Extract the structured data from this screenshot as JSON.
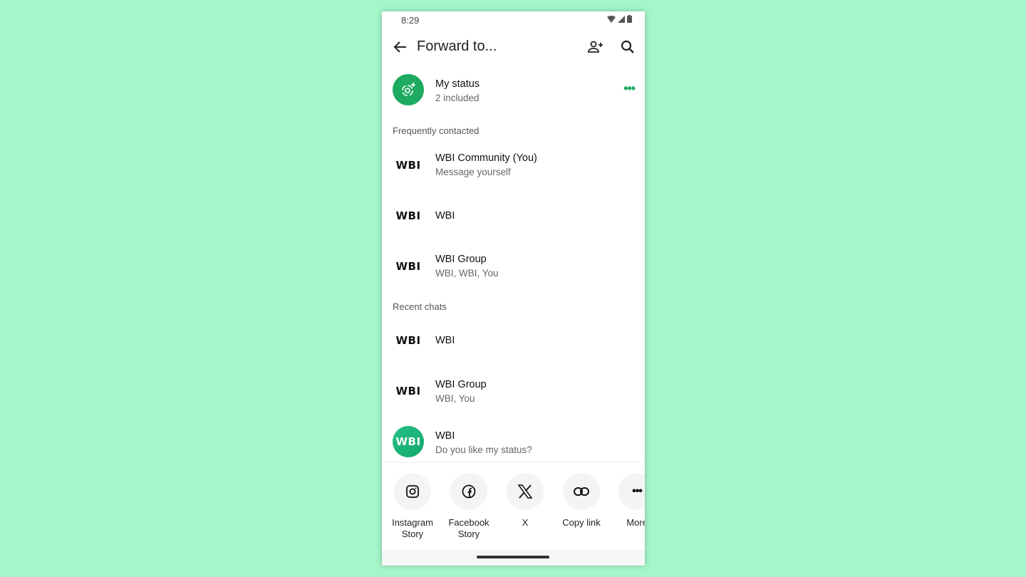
{
  "status_bar": {
    "time": "8:29"
  },
  "app_bar": {
    "title": "Forward to..."
  },
  "my_status": {
    "name": "My status",
    "sub": "2 included"
  },
  "sections": {
    "frequent": "Frequently contacted",
    "recent": "Recent chats"
  },
  "frequent": [
    {
      "avatar": "WBI",
      "name": "WBI Community (You)",
      "sub": "Message yourself"
    },
    {
      "avatar": "WBI",
      "name": "WBI",
      "sub": ""
    },
    {
      "avatar": "WBI",
      "name": "WBI Group",
      "sub": "WBI, WBI, You"
    }
  ],
  "recent": [
    {
      "avatar": "WBI",
      "name": "WBI",
      "sub": ""
    },
    {
      "avatar": "WBI",
      "name": "WBI Group",
      "sub": "WBI, You"
    },
    {
      "avatar": "WBI",
      "name": "WBI",
      "sub": "Do you like my status?"
    }
  ],
  "share": [
    {
      "label": "Instagram Story",
      "icon": "instagram-icon"
    },
    {
      "label": "Facebook Story",
      "icon": "facebook-icon"
    },
    {
      "label": "X",
      "icon": "x-icon"
    },
    {
      "label": "Copy link",
      "icon": "link-icon"
    },
    {
      "label": "More",
      "icon": "more-icon"
    }
  ],
  "colors": {
    "accent": "#1daa61",
    "background": "#a4f7c9"
  }
}
